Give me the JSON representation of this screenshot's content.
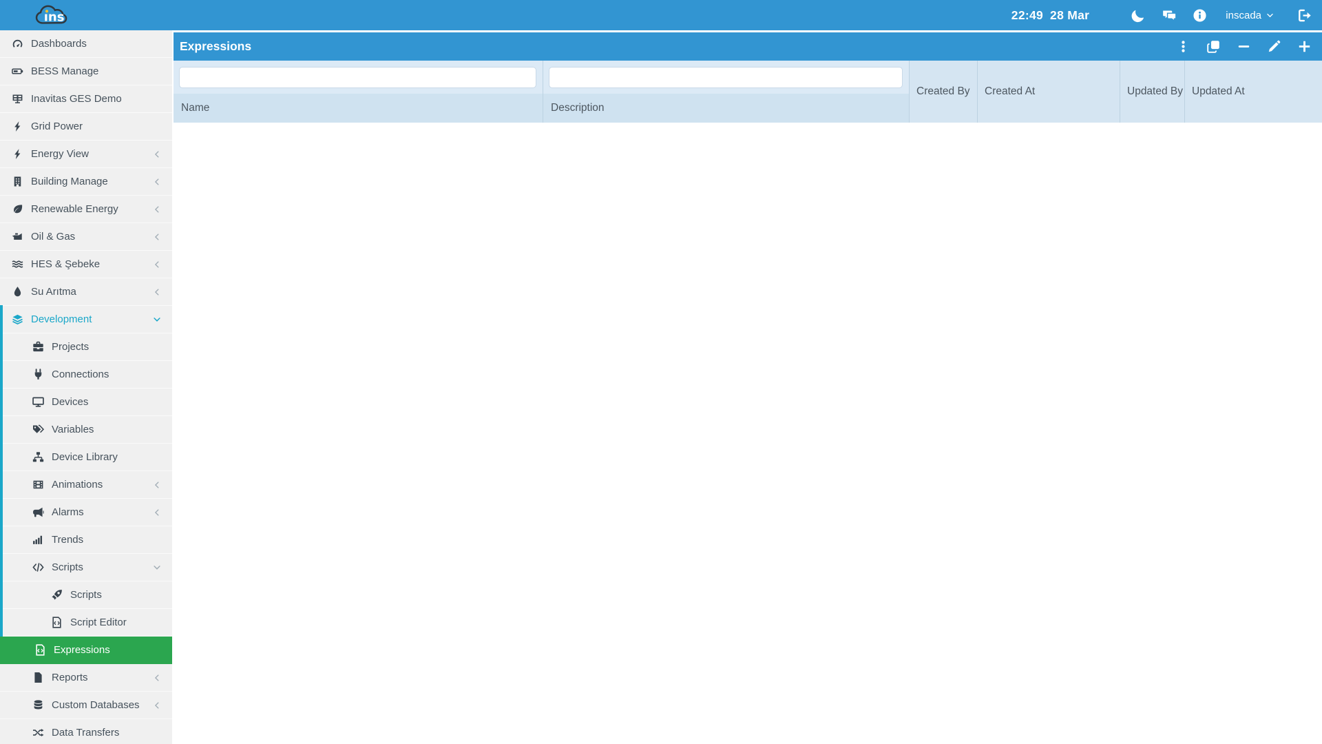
{
  "topbar": {
    "logo_text": "ins",
    "clock": {
      "time": "22:49",
      "date": "28 Mar"
    },
    "icons": [
      {
        "name": "moon"
      },
      {
        "name": "chat"
      },
      {
        "name": "info"
      }
    ],
    "user_menu": {
      "label": "inscada"
    },
    "logout": {
      "name": "sign-out"
    }
  },
  "sidebar": {
    "items": [
      {
        "label": "Dashboards",
        "icon": "gauge",
        "level": 1
      },
      {
        "label": "BESS Manage",
        "icon": "battery",
        "level": 1
      },
      {
        "label": "Inavitas GES Demo",
        "icon": "solar-panel",
        "level": 1
      },
      {
        "label": "Grid Power",
        "icon": "bolt",
        "level": 1
      },
      {
        "label": "Energy View",
        "icon": "bolt",
        "level": 1,
        "chevron": "left"
      },
      {
        "label": "Building Manage",
        "icon": "building",
        "level": 1,
        "chevron": "left"
      },
      {
        "label": "Renewable Energy",
        "icon": "leaf",
        "level": 1,
        "chevron": "left"
      },
      {
        "label": "Oil & Gas",
        "icon": "oil-can",
        "level": 1,
        "chevron": "left"
      },
      {
        "label": "HES & Şebeke",
        "icon": "waves",
        "level": 1,
        "chevron": "left"
      },
      {
        "label": "Su Arıtma",
        "icon": "droplet",
        "level": 1,
        "chevron": "left"
      },
      {
        "label": "Development",
        "icon": "layers",
        "level": 1,
        "chevron": "down",
        "highlight": true,
        "trail": true
      },
      {
        "label": "Projects",
        "icon": "briefcase",
        "level": 2,
        "trail": true
      },
      {
        "label": "Connections",
        "icon": "plug",
        "level": 2,
        "trail": true
      },
      {
        "label": "Devices",
        "icon": "monitor",
        "level": 2,
        "trail": true
      },
      {
        "label": "Variables",
        "icon": "tags",
        "level": 2,
        "trail": true
      },
      {
        "label": "Device Library",
        "icon": "sitemap",
        "level": 2,
        "trail": true
      },
      {
        "label": "Animations",
        "icon": "film",
        "level": 2,
        "chevron": "left",
        "trail": true
      },
      {
        "label": "Alarms",
        "icon": "bullhorn",
        "level": 2,
        "chevron": "left",
        "trail": true
      },
      {
        "label": "Trends",
        "icon": "bar-chart",
        "level": 2,
        "trail": true
      },
      {
        "label": "Scripts",
        "icon": "code",
        "level": 2,
        "chevron": "down",
        "trail": true
      },
      {
        "label": "Scripts",
        "icon": "rocket",
        "level": 3,
        "trail": true
      },
      {
        "label": "Script Editor",
        "icon": "file-code",
        "level": 3,
        "trail": true
      },
      {
        "label": "Expressions",
        "icon": "file-code",
        "level": 3,
        "active": true
      },
      {
        "label": "Reports",
        "icon": "file",
        "level": 2,
        "chevron": "left"
      },
      {
        "label": "Custom Databases",
        "icon": "database",
        "level": 2,
        "chevron": "left"
      },
      {
        "label": "Data Transfers",
        "icon": "shuffle",
        "level": 2
      }
    ]
  },
  "panel": {
    "title": "Expressions",
    "toolbar": [
      {
        "name": "ellipsis-v"
      },
      {
        "name": "clone"
      },
      {
        "name": "minus"
      },
      {
        "name": "pencil"
      },
      {
        "name": "plus"
      }
    ]
  },
  "table": {
    "columns": [
      {
        "label": "Name",
        "has_filter": true,
        "filter_value": "",
        "filter_placeholder": ""
      },
      {
        "label": "Description",
        "has_filter": true,
        "filter_value": "",
        "filter_placeholder": ""
      },
      {
        "label": "Created By"
      },
      {
        "label": "Created At"
      },
      {
        "label": "Updated By"
      },
      {
        "label": "Updated At"
      }
    ],
    "rows": []
  },
  "colors": {
    "primary_blue": "#3295d2",
    "active_teal": "#1ba7c9",
    "active_green": "#2ba64f",
    "sidebar_bg": "#f0f0f0",
    "filter_zone_bg": "#dceaf6",
    "header_zone_bg": "#cfe2f0",
    "logo_dot_yellow": "#f2c230"
  }
}
